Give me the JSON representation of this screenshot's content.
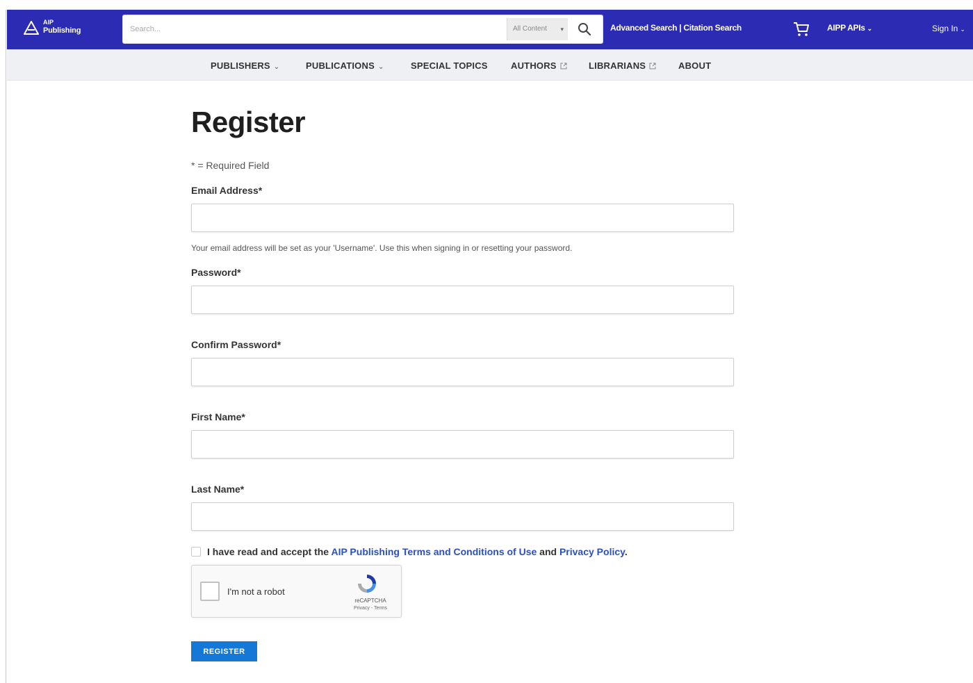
{
  "header": {
    "logo_line1": "AIP",
    "logo_line2": "Publishing",
    "search_placeholder": "Search...",
    "search_scope": "All Content",
    "advanced_search": "Advanced Search | Citation Search",
    "aipp_apis": "AIPP APIs",
    "sign_in": "Sign In"
  },
  "nav": {
    "items": [
      {
        "label": "PUBLISHERS"
      },
      {
        "label": "PUBLICATIONS"
      },
      {
        "label": "SPECIAL TOPICS"
      },
      {
        "label": "AUTHORS"
      },
      {
        "label": "LIBRARIANS"
      },
      {
        "label": "ABOUT"
      }
    ]
  },
  "form": {
    "title": "Register",
    "required_note": "* = Required Field",
    "email_label": "Email Address*",
    "email_help": "Your email address will be set as your 'Username'. Use this when signing in or resetting your password.",
    "password_label": "Password*",
    "confirm_password_label": "Confirm Password*",
    "first_name_label": "First Name*",
    "last_name_label": "Last Name*",
    "terms_prefix": "I have read and accept the ",
    "terms_link": "AIP Publishing Terms and Conditions of Use",
    "terms_middle": " and ",
    "privacy_link": "Privacy Policy",
    "terms_suffix": ".",
    "register_button": "REGISTER"
  },
  "recaptcha": {
    "label": "I'm not a robot",
    "brand": "reCAPTCHA",
    "links": "Privacy - Terms"
  },
  "colors": {
    "header_bg": "#2b2bb3",
    "nav_bg": "#eef0f3",
    "link": "#2c4fc0",
    "button": "#1678d6"
  }
}
